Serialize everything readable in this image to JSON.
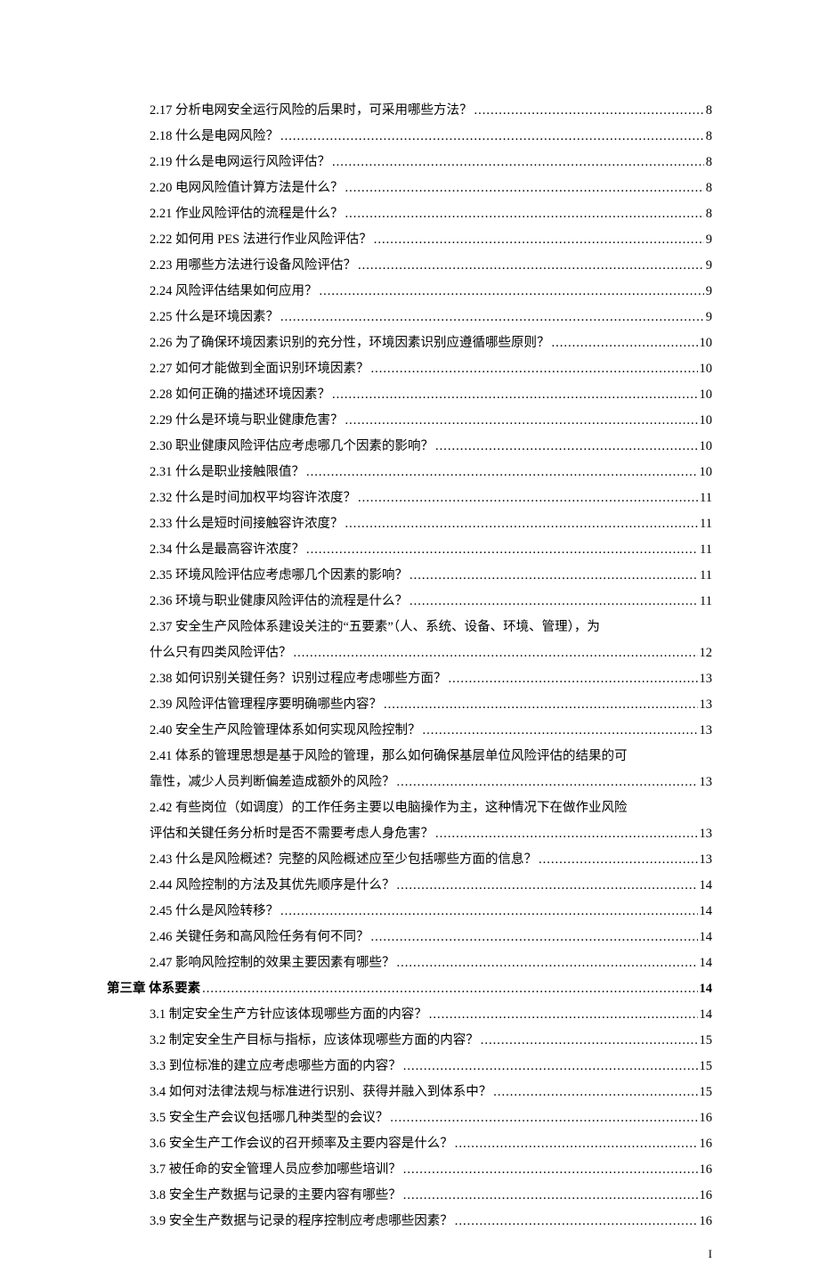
{
  "page_number": "I",
  "entries": [
    {
      "indent": 1,
      "num": "2.17",
      "title": "分析电网安全运行风险的后果时，可采用哪些方法？",
      "page": "8"
    },
    {
      "indent": 1,
      "num": "2.18",
      "title": "什么是电网风险？",
      "page": "8"
    },
    {
      "indent": 1,
      "num": "2.19",
      "title": "什么是电网运行风险评估？",
      "page": "8"
    },
    {
      "indent": 1,
      "num": "2.20",
      "title": "电网风险值计算方法是什么？",
      "page": "8"
    },
    {
      "indent": 1,
      "num": "2.21",
      "title": "作业风险评估的流程是什么？",
      "page": "8"
    },
    {
      "indent": 1,
      "num": "2.22",
      "title": "如何用 PES 法进行作业风险评估？",
      "page": "9"
    },
    {
      "indent": 1,
      "num": "2.23",
      "title": "用哪些方法进行设备风险评估？",
      "page": "9"
    },
    {
      "indent": 1,
      "num": "2.24",
      "title": "风险评估结果如何应用？",
      "page": "9"
    },
    {
      "indent": 1,
      "num": "2.25",
      "title": "什么是环境因素？",
      "page": "9"
    },
    {
      "indent": 1,
      "num": "2.26",
      "title": "为了确保环境因素识别的充分性，环境因素识别应遵循哪些原则？",
      "page": "10"
    },
    {
      "indent": 1,
      "num": "2.27",
      "title": "如何才能做到全面识别环境因素？",
      "page": "10"
    },
    {
      "indent": 1,
      "num": "2.28",
      "title": "如何正确的描述环境因素？",
      "page": "10"
    },
    {
      "indent": 1,
      "num": "2.29",
      "title": "什么是环境与职业健康危害？",
      "page": "10"
    },
    {
      "indent": 1,
      "num": "2.30",
      "title": "职业健康风险评估应考虑哪几个因素的影响？",
      "page": "10"
    },
    {
      "indent": 1,
      "num": "2.31",
      "title": "什么是职业接触限值？",
      "page": "10"
    },
    {
      "indent": 1,
      "num": "2.32",
      "title": "什么是时间加权平均容许浓度？",
      "page": "11"
    },
    {
      "indent": 1,
      "num": "2.33",
      "title": "什么是短时间接触容许浓度？",
      "page": "11"
    },
    {
      "indent": 1,
      "num": "2.34",
      "title": "什么是最高容许浓度？",
      "page": "11"
    },
    {
      "indent": 1,
      "num": "2.35",
      "title": "环境风险评估应考虑哪几个因素的影响？",
      "page": "11"
    },
    {
      "indent": 1,
      "num": "2.36",
      "title": "环境与职业健康风险评估的流程是什么？",
      "page": "11"
    },
    {
      "indent": 1,
      "num": "2.37",
      "title_line1": "安全生产风险体系建设关注的“五要素”（人、系统、设备、环境、管理），为",
      "title_line2": "什么只有四类风险评估？",
      "page": "12",
      "multiline": true
    },
    {
      "indent": 1,
      "num": "2.38",
      "title": "如何识别关键任务？识别过程应考虑哪些方面？",
      "page": "13"
    },
    {
      "indent": 1,
      "num": "2.39",
      "title": "风险评估管理程序要明确哪些内容？",
      "page": "13"
    },
    {
      "indent": 1,
      "num": "2.40",
      "title": "安全生产风险管理体系如何实现风险控制？",
      "page": "13"
    },
    {
      "indent": 1,
      "num": "2.41",
      "title_line1": "体系的管理思想是基于风险的管理，那么如何确保基层单位风险评估的结果的可",
      "title_line2": "靠性，减少人员判断偏差造成额外的风险？",
      "page": "13",
      "multiline": true
    },
    {
      "indent": 1,
      "num": "2.42",
      "title_line1": "有些岗位（如调度）的工作任务主要以电脑操作为主，这种情况下在做作业风险",
      "title_line2": "评估和关键任务分析时是否不需要考虑人身危害？",
      "page": "13",
      "multiline": true
    },
    {
      "indent": 1,
      "num": "2.43",
      "title": "什么是风险概述？完整的风险概述应至少包括哪些方面的信息？",
      "page": "13"
    },
    {
      "indent": 1,
      "num": "2.44",
      "title": "风险控制的方法及其优先顺序是什么？",
      "page": "14"
    },
    {
      "indent": 1,
      "num": "2.45",
      "title": "什么是风险转移？",
      "page": "14"
    },
    {
      "indent": 1,
      "num": "2.46",
      "title": "关键任务和高风险任务有何不同？",
      "page": "14"
    },
    {
      "indent": 1,
      "num": "2.47",
      "title": "影响风险控制的效果主要因素有哪些？",
      "page": "14"
    },
    {
      "indent": 0,
      "num": "第三章",
      "title": "体系要素",
      "page": "14"
    },
    {
      "indent": 1,
      "num": "3.1",
      "title": "制定安全生产方针应该体现哪些方面的内容？",
      "page": "14"
    },
    {
      "indent": 1,
      "num": "3.2",
      "title": "制定安全生产目标与指标，应该体现哪些方面的内容？",
      "page": "15"
    },
    {
      "indent": 1,
      "num": "3.3",
      "title": "到位标准的建立应考虑哪些方面的内容？",
      "page": "15"
    },
    {
      "indent": 1,
      "num": "3.4",
      "title": "如何对法律法规与标准进行识别、获得并融入到体系中？",
      "page": "15"
    },
    {
      "indent": 1,
      "num": "3.5",
      "title": "安全生产会议包括哪几种类型的会议？",
      "page": "16"
    },
    {
      "indent": 1,
      "num": "3.6",
      "title": "安全生产工作会议的召开频率及主要内容是什么？",
      "page": "16"
    },
    {
      "indent": 1,
      "num": "3.7",
      "title": "被任命的安全管理人员应参加哪些培训？",
      "page": "16"
    },
    {
      "indent": 1,
      "num": "3.8",
      "title": "安全生产数据与记录的主要内容有哪些？",
      "page": "16"
    },
    {
      "indent": 1,
      "num": "3.9",
      "title": "安全生产数据与记录的程序控制应考虑哪些因素？",
      "page": "16"
    }
  ]
}
